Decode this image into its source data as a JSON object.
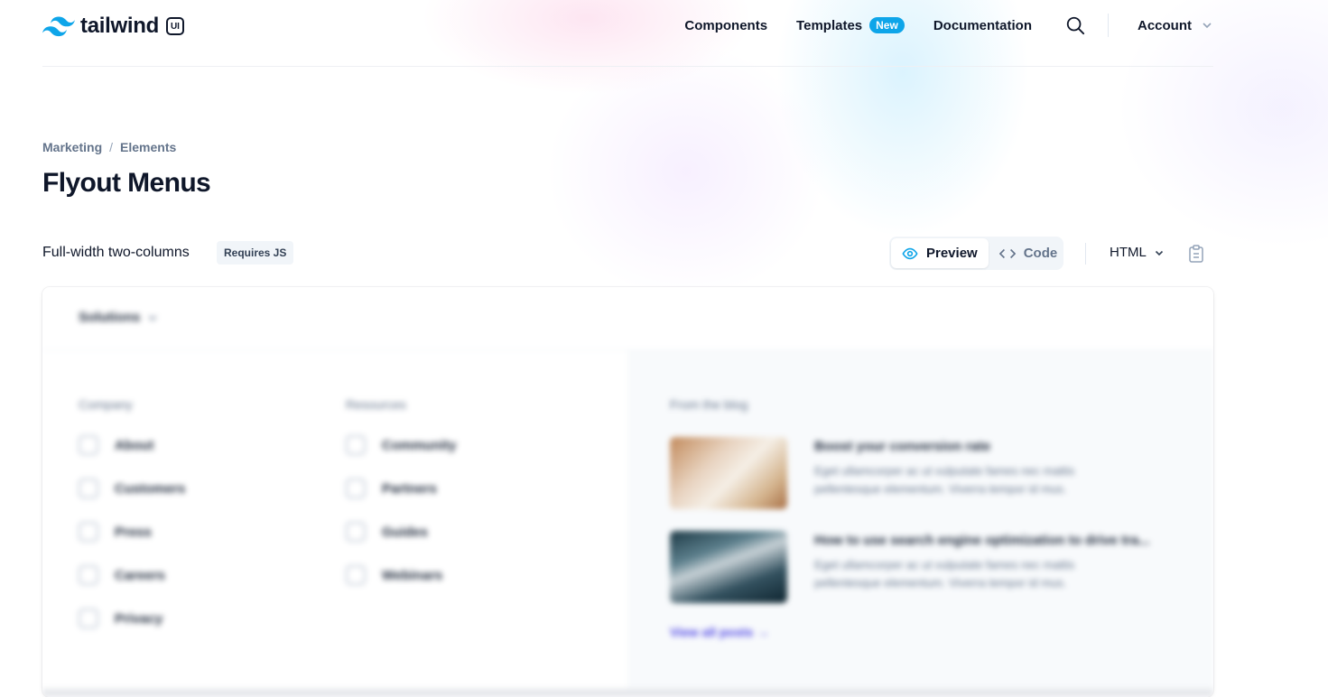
{
  "header": {
    "logo_text": "tailwind",
    "logo_badge": "UI",
    "nav": {
      "components": "Components",
      "templates": "Templates",
      "templates_badge": "New",
      "documentation": "Documentation",
      "account": "Account"
    }
  },
  "breadcrumb": [
    "Marketing",
    "Elements"
  ],
  "page_title": "Flyout Menus",
  "example": {
    "title": "Full-width two-columns",
    "badge": "Requires JS",
    "tabs": {
      "preview": "Preview",
      "code": "Code"
    },
    "language": "HTML"
  },
  "preview": {
    "trigger": "Solutions",
    "columns": [
      {
        "heading": "Company",
        "items": [
          "About",
          "Customers",
          "Press",
          "Careers",
          "Privacy"
        ]
      },
      {
        "heading": "Resources",
        "items": [
          "Community",
          "Partners",
          "Guides",
          "Webinars"
        ]
      }
    ],
    "blog": {
      "heading": "From the blog",
      "posts": [
        {
          "title": "Boost your conversion rate",
          "body": "Eget ullamcorper ac ut vulputate fames nec mattis pellentesque elementum. Viverra tempor id mus."
        },
        {
          "title": "How to use search engine optimization to drive tra...",
          "body": "Eget ullamcorper ac ut vulputate fames nec mattis pellentesque elementum. Viverra tempor id mus."
        }
      ],
      "view_all": "View all posts →"
    }
  },
  "colors": {
    "accent": "#0ea5e9",
    "link": "#4f46e5",
    "text": "#0f172a"
  }
}
